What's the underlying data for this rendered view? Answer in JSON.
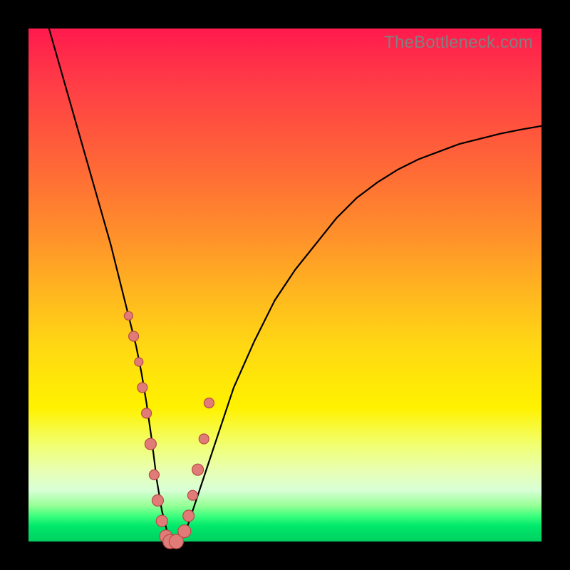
{
  "watermark": "TheBottleneck.com",
  "colors": {
    "background_black": "#000000",
    "gradient_top": "#ff1a4d",
    "gradient_bottom": "#00d060",
    "curve_stroke": "#000000",
    "dot_fill": "#e07b78",
    "dot_stroke": "#b84b46",
    "watermark_text": "#808080"
  },
  "chart_data": {
    "type": "line",
    "title": "",
    "xlabel": "",
    "ylabel": "",
    "xlim": [
      0,
      100
    ],
    "ylim": [
      0,
      100
    ],
    "grid": false,
    "legend": false,
    "series": [
      {
        "name": "bottleneck-curve",
        "x": [
          4,
          6,
          8,
          10,
          12,
          14,
          16,
          18,
          20,
          21,
          22,
          23,
          24,
          25,
          26,
          27,
          28,
          29,
          30,
          31,
          32,
          34,
          36,
          38,
          40,
          44,
          48,
          52,
          56,
          60,
          64,
          68,
          72,
          76,
          80,
          84,
          88,
          92,
          96,
          100
        ],
        "y": [
          100,
          93,
          86,
          79,
          72,
          65,
          58,
          50,
          42,
          38,
          33,
          27,
          20,
          12,
          6,
          2,
          0,
          0,
          1,
          3,
          6,
          12,
          18,
          24,
          30,
          39,
          47,
          53,
          58,
          63,
          67,
          70,
          72.5,
          74.5,
          76,
          77.5,
          78.5,
          79.5,
          80.3,
          81
        ]
      }
    ],
    "dots": {
      "name": "highlighted-points",
      "x": [
        19.5,
        20.5,
        21.5,
        22.2,
        23.0,
        23.8,
        24.5,
        25.2,
        26.0,
        26.8,
        27.6,
        28.8,
        30.4,
        31.2,
        32.0,
        33.0,
        34.2,
        35.2
      ],
      "y": [
        44,
        40,
        35,
        30,
        25,
        19,
        13,
        8,
        4,
        1,
        0,
        0,
        2,
        5,
        9,
        14,
        20,
        27
      ],
      "r": [
        6,
        7,
        6,
        7,
        7,
        8,
        7,
        8,
        8,
        9,
        10,
        10,
        9,
        8,
        7,
        8,
        7,
        7
      ]
    }
  }
}
